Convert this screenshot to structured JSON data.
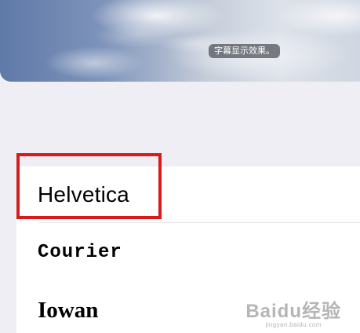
{
  "preview": {
    "subtitle_text": "字幕显示效果。"
  },
  "fonts": [
    {
      "label": "Helvetica"
    },
    {
      "label": "Courier"
    },
    {
      "label": "Iowan"
    }
  ],
  "watermark": {
    "logo": "Baidu经验",
    "url": "jingyan.baidu.com"
  },
  "colors": {
    "highlight": "#d91a1a"
  }
}
